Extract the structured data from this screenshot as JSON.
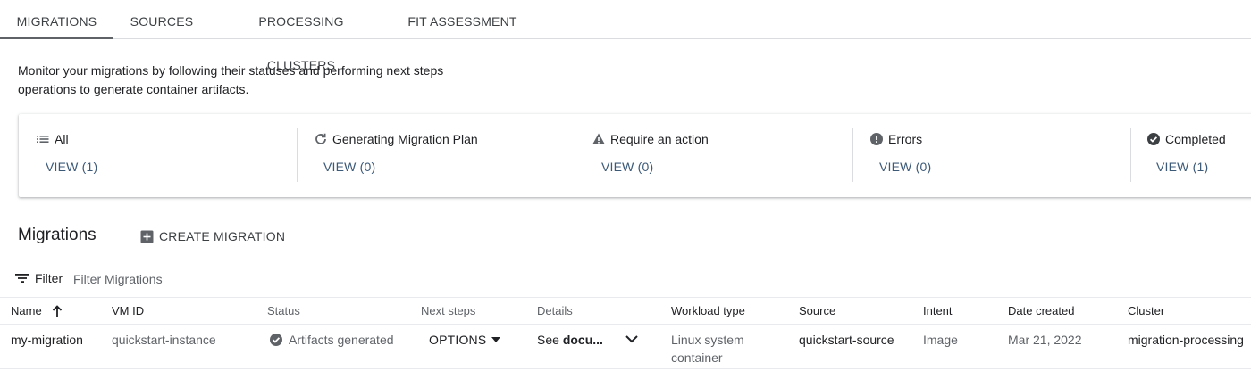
{
  "tabs": [
    {
      "label": "MIGRATIONS",
      "active": true
    },
    {
      "label": "SOURCES",
      "active": false
    },
    {
      "label": "PROCESSING CLUSTERS",
      "active": false
    },
    {
      "label": "FIT ASSESSMENT",
      "active": false
    }
  ],
  "intro": {
    "line1": "Monitor your migrations by following their statuses and performing next steps",
    "line2": "operations to generate container artifacts."
  },
  "status_cards": [
    {
      "icon": "list-icon",
      "label": "All",
      "view": "VIEW (1)"
    },
    {
      "icon": "refresh-icon",
      "label": "Generating Migration Plan",
      "view": "VIEW (0)"
    },
    {
      "icon": "warning-icon",
      "label": "Require an action",
      "view": "VIEW (0)"
    },
    {
      "icon": "error-icon",
      "label": "Errors",
      "view": "VIEW (0)"
    },
    {
      "icon": "check-circle-icon",
      "label": "Completed",
      "view": "VIEW (1)"
    }
  ],
  "migrations": {
    "title": "Migrations",
    "create_label": "CREATE MIGRATION"
  },
  "filter": {
    "label": "Filter",
    "placeholder": "Filter Migrations"
  },
  "table": {
    "columns": [
      "Name",
      "VM ID",
      "Status",
      "Next steps",
      "Details",
      "Workload type",
      "Source",
      "Intent",
      "Date created",
      "Cluster"
    ],
    "sort_column": "Name",
    "sort_direction": "ascending",
    "rows": [
      {
        "name": "my-migration",
        "vm_id": "quickstart-instance",
        "status": "Artifacts generated",
        "next_steps": "OPTIONS",
        "details_prefix": "See ",
        "details_bold": "docu...",
        "workload_line1": "Linux system",
        "workload_line2": "container",
        "source": "quickstart-source",
        "intent": "Image",
        "date_created": "Mar 21, 2022",
        "cluster": "migration-processing"
      }
    ]
  },
  "colors": {
    "view_link": "#3c5a78",
    "tab_underline": "#5f6368",
    "icon": "#5f6368"
  }
}
